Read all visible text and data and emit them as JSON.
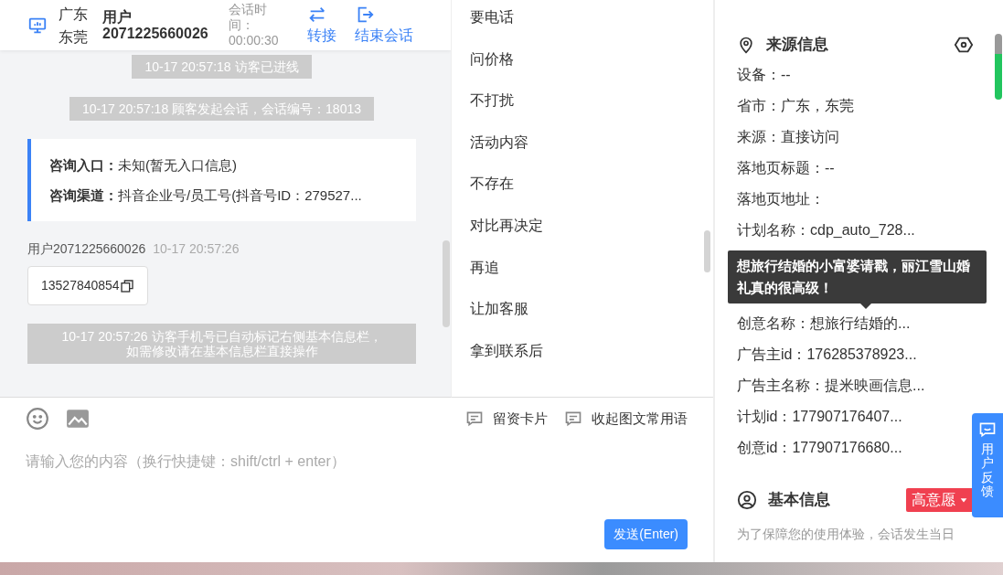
{
  "header": {
    "location": "广东东莞",
    "user": "用户 2071225660026",
    "session_time": "会话时间：00:00:30",
    "actions": [
      {
        "kind": "transfer",
        "label": "转接"
      },
      {
        "kind": "exit",
        "label": "结束会话"
      }
    ]
  },
  "messages": [
    {
      "kind": "system",
      "lines": [
        "10-17 20:57:18 访客已进线"
      ]
    },
    {
      "kind": "system",
      "lines": [
        "10-17 20:57:18 顾客发起会话，会话编号：18013"
      ]
    },
    {
      "kind": "info",
      "rows": [
        {
          "label": "咨询入口：",
          "value": "未知(暂无入口信息)"
        },
        {
          "label": "咨询渠道：",
          "value": "抖音企业号/员工号(抖音号ID：279527..."
        }
      ]
    },
    {
      "kind": "user",
      "sender": "用户2071225660026",
      "time": "10-17 20:57:26",
      "text": "13527840854"
    },
    {
      "kind": "system",
      "lines": [
        "10-17 20:57:26 访客手机号已自动标记右侧基本信息栏，",
        "如需修改请在基本信息栏直接操作"
      ]
    }
  ],
  "quick_phrases": [
    "要电话",
    "问价格",
    "不打扰",
    "活动内容",
    "不存在",
    "对比再决定",
    "再追",
    "让加客服",
    "拿到联系后"
  ],
  "composer": {
    "tools": [
      {
        "label": "留资卡片"
      },
      {
        "label": "收起图文常用语"
      }
    ],
    "placeholder": "请输入您的内容（换行快捷键：shift/ctrl + enter）",
    "send": "发送(Enter)"
  },
  "source_info": {
    "title": "来源信息",
    "rows": [
      {
        "text": "设备：--"
      },
      {
        "text": "省市：广东，东莞"
      },
      {
        "text": "来源：直接访问"
      },
      {
        "text": "落地页标题：--"
      },
      {
        "text": "落地页地址："
      },
      {
        "text": "计划名称：cdp_auto_728..."
      },
      {
        "text": "创意名称：想旅行结婚的...",
        "tooltip": "想旅行结婚的小富婆请戳，丽江雪山婚礼真的很高级！"
      },
      {
        "text": "广告主id：176285378923..."
      },
      {
        "text": "广告主名称：提米映画信息..."
      },
      {
        "text": "计划id：177907176407..."
      },
      {
        "text": "创意id：177907176680..."
      }
    ]
  },
  "basic_info": {
    "title": "基本信息",
    "tag": "高意愿",
    "note": "为了保障您的使用体验，会话发生当日"
  },
  "feedback": {
    "label": "用户反馈"
  }
}
